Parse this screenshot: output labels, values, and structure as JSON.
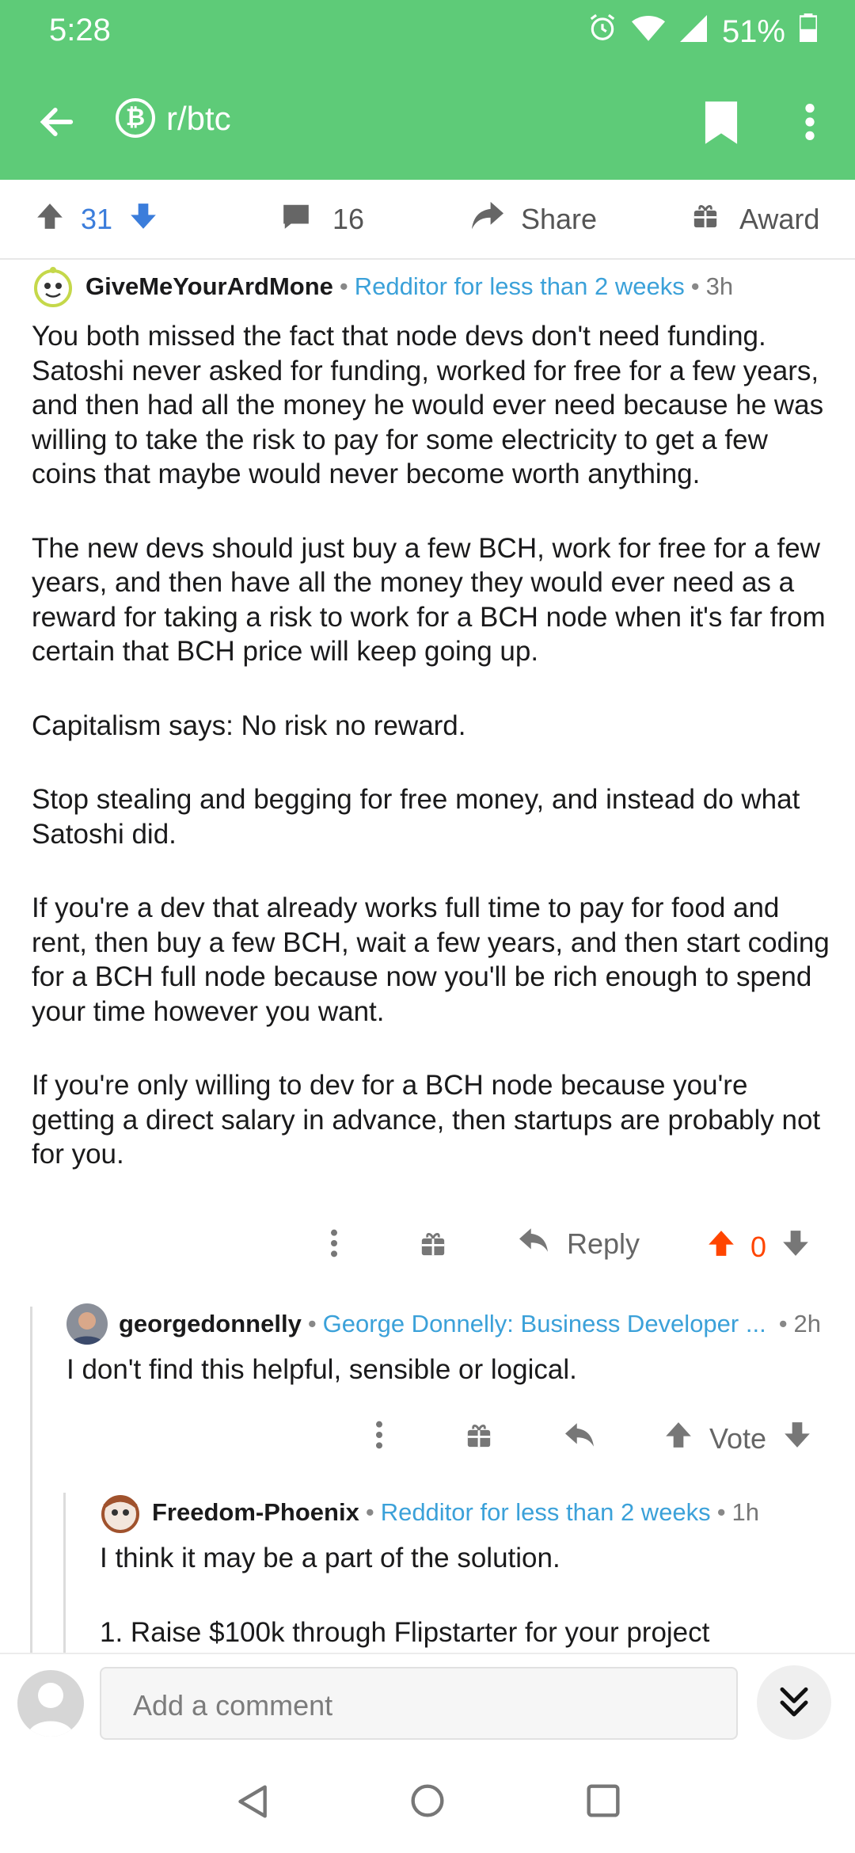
{
  "status": {
    "time": "5:28",
    "battery": "51%"
  },
  "header": {
    "subreddit": "r/btc",
    "subreddit_icon": "₿"
  },
  "post_actions": {
    "score": "31",
    "comments": "16",
    "share": "Share",
    "award": "Award"
  },
  "comments": [
    {
      "author": "GiveMeYourArdMone",
      "flair": "Redditor for less than 2 weeks",
      "time": "3h",
      "paragraphs": [
        "You both missed the fact that node devs don't need funding. Satoshi never asked for funding, worked for free for a few years, and then had all the money he would ever need because he was willing to take the risk to pay for some electricity to get a few coins that maybe would never become worth anything.",
        "The new devs should just buy a few BCH, work for free for a few years, and then have all the money they would ever need as a reward for taking a risk to work for a BCH node when it's far from certain that BCH price will keep going up.",
        "Capitalism says: No risk no reward.",
        "Stop stealing and begging for free money, and instead do what Satoshi did.",
        "If you're a dev that already works full time to pay for food and rent, then buy a few BCH, wait a few years, and then start coding for a BCH full node because now you'll be rich enough to spend your time however you want.",
        "If you're only willing to dev for a BCH node because you're getting a direct salary in advance, then startups are probably not for you."
      ],
      "reply_label": "Reply",
      "score": "0"
    },
    {
      "author": "georgedonnelly",
      "flair": "George Donnelly: Business Developer ...",
      "time": "2h",
      "paragraphs": [
        "I don't find this helpful, sensible or logical."
      ],
      "vote_label": "Vote"
    },
    {
      "author": "Freedom-Phoenix",
      "flair": "Redditor for less than 2 weeks",
      "time": "1h",
      "paragraphs": [
        "I think it may be a part of the solution.",
        "1. Raise $100k through Flipstarter for your project"
      ]
    }
  ],
  "composer": {
    "placeholder": "Add a comment"
  },
  "colors": {
    "header": "#5ecb78",
    "upvote_active": "#ff4500",
    "blue": "#3b7ddb",
    "flair": "#3ba1d9"
  }
}
